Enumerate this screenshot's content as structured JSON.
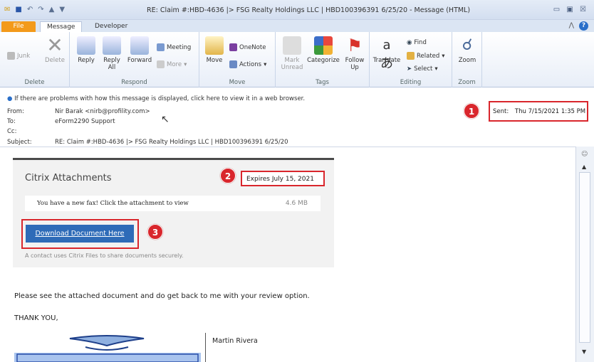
{
  "window": {
    "title": "RE: Claim #:HBD-4636 |> FSG Realty Holdings LLC | HBD100396391 6/25/20 - Message (HTML)",
    "controls": "▭ ▣ ☒"
  },
  "tabs": {
    "file": "File",
    "message": "Message",
    "developer": "Developer"
  },
  "ribbon": {
    "delete": {
      "junk": "Junk",
      "delete": "Delete",
      "group": "Delete"
    },
    "respond": {
      "reply": "Reply",
      "reply_all": "Reply All",
      "forward": "Forward",
      "meeting": "Meeting",
      "more": "More",
      "group": "Respond"
    },
    "move": {
      "move": "Move",
      "onenote": "OneNote",
      "actions": "Actions",
      "group": "Move"
    },
    "tags": {
      "mark_unread": "Mark Unread",
      "categorize": "Categorize",
      "follow_up": "Follow Up",
      "group": "Tags"
    },
    "editing": {
      "translate": "Translate",
      "find": "Find",
      "related": "Related",
      "select": "Select",
      "group": "Editing"
    },
    "zoom": {
      "zoom": "Zoom",
      "group": "Zoom"
    }
  },
  "header": {
    "info": "If there are problems with how this message is displayed, click here to view it in a web browser.",
    "from_label": "From:",
    "from": "Nir Barak <nirb@profility.com>",
    "to_label": "To:",
    "to": "eForm2290 Support",
    "cc_label": "Cc:",
    "subject_label": "Subject:",
    "subject": "RE: Claim #:HBD-4636 |> FSG Realty Holdings LLC | HBD100396391 6/25/20",
    "sent_label": "Sent:",
    "sent": "Thu 7/15/2021 1:35 PM"
  },
  "markers": [
    "1",
    "2",
    "3"
  ],
  "citrix": {
    "title": "Citrix Attachments",
    "expires": "Expires July 15, 2021",
    "file_text": "You have a new fax! Click the attachment to view",
    "file_size": "4.6 MB",
    "download": "Download Document Here",
    "note": "A contact uses Citrix Files to share documents securely."
  },
  "body": {
    "line1": "Please see the attached document and do get back to me with your review option.",
    "line2": "THANK YOU,",
    "signature_name": "Martin Rivera"
  },
  "colors": {
    "highlight": "#d9262c",
    "citrix_button": "#2e6bb8",
    "file_tab": "#f39a1a"
  }
}
